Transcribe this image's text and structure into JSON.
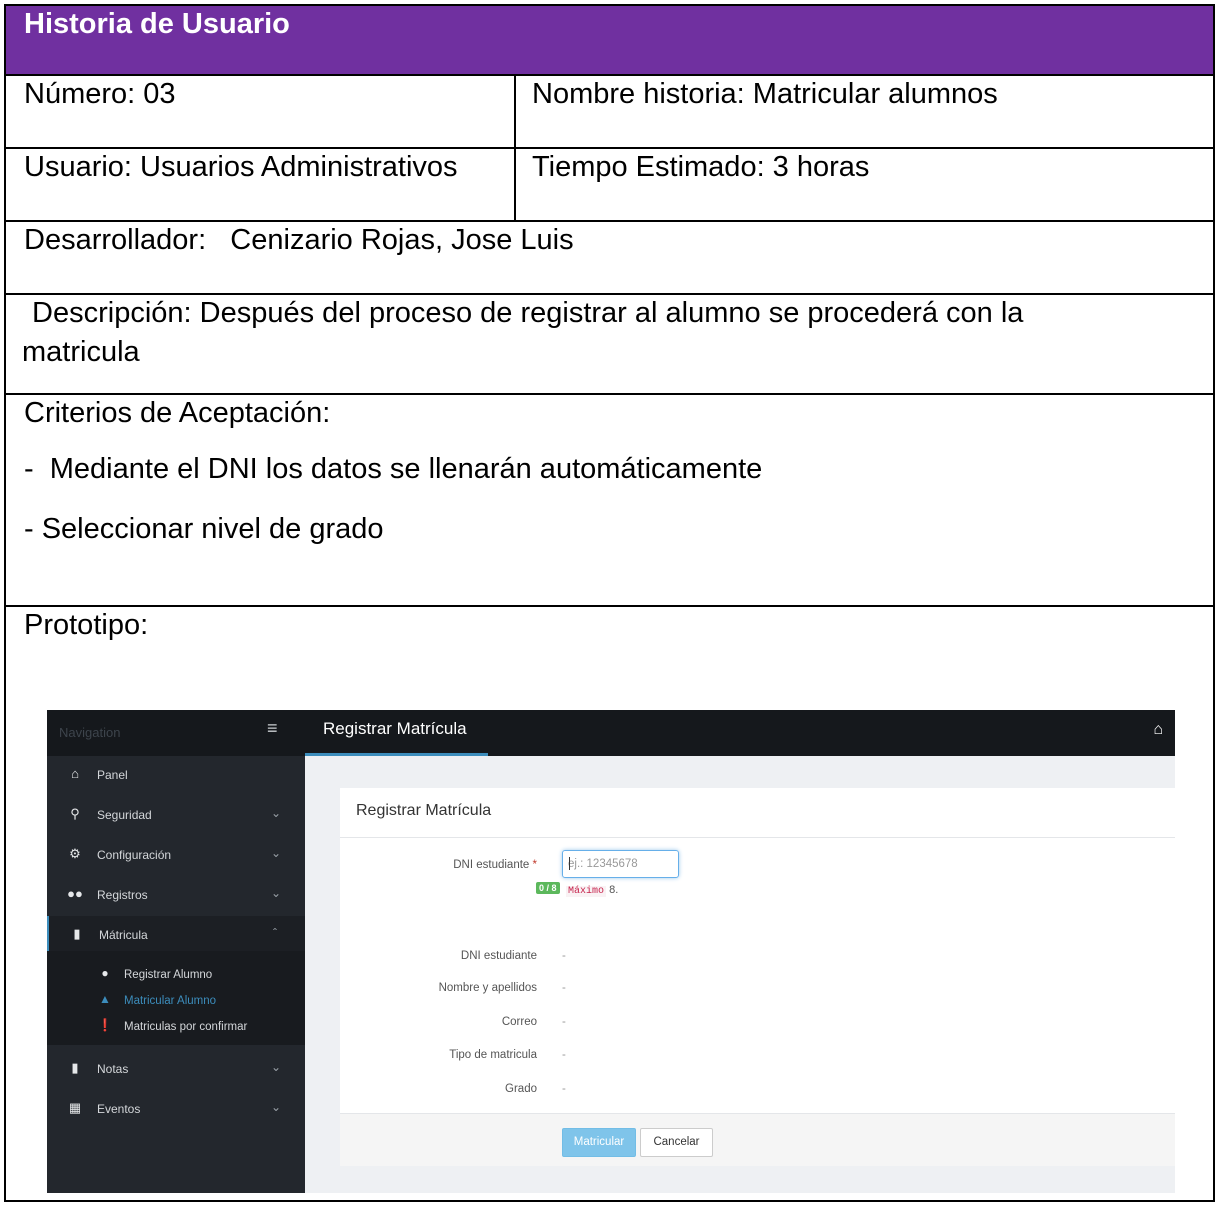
{
  "story": {
    "header": "Historia de Usuario",
    "numero": "Número: 03",
    "nombre_historia": "Nombre historia: Matricular alumnos",
    "usuario": "Usuario: Usuarios Administrativos",
    "tiempo": "Tiempo Estimado: 3 horas",
    "desarrollador": "Desarrollador:   Cenizario Rojas, Jose Luis",
    "descripcion_1": " Descripción: Después del proceso de registrar al alumno se procederá con la",
    "descripcion_2": "matricula",
    "criterios_title": "Criterios de Aceptación:",
    "criterios": [
      "-  Mediante el DNI los datos se llenarán automáticamente",
      "- Seleccionar nivel de grado"
    ],
    "prototipo_label": "Prototipo:",
    "header_color": "#7030a0"
  },
  "prototype": {
    "nav_title": "Navigation",
    "menu_icon": "hamburger-icon",
    "page_title": "Registrar Matrícula",
    "home_icon": "home-icon",
    "sidebar": {
      "items": [
        {
          "label": "Panel",
          "icon": "home-icon"
        },
        {
          "label": "Seguridad",
          "icon": "key-icon"
        },
        {
          "label": "Configuración",
          "icon": "gears-icon"
        },
        {
          "label": "Registros",
          "icon": "users-icon"
        },
        {
          "label": "Mátricula",
          "icon": "book-icon"
        },
        {
          "label": "Notas",
          "icon": "book-icon"
        },
        {
          "label": "Eventos",
          "icon": "calendar-icon"
        }
      ],
      "sub_items": [
        {
          "label": "Registrar Alumno",
          "icon": "user-icon"
        },
        {
          "label": "Matricular Alumno",
          "icon": "graduation-cap-icon"
        },
        {
          "label": "Matriculas por confirmar",
          "icon": "exclamation-circle-icon"
        }
      ]
    },
    "form": {
      "title": "Registrar Matrícula",
      "dni_label": "DNI estudiante",
      "required_mark": "*",
      "dni_placeholder": "ej.: 12345678",
      "counter": "0 / 8",
      "max_code": "Máximo",
      "max_rest": " 8.",
      "fields": [
        {
          "label": "DNI estudiante",
          "value": "-"
        },
        {
          "label": "Nombre y apellidos",
          "value": "-"
        },
        {
          "label": "Correo",
          "value": "-"
        },
        {
          "label": "Tipo de matricula",
          "value": "-"
        },
        {
          "label": "Grado",
          "value": "-"
        }
      ],
      "submit": "Matricular",
      "cancel": "Cancelar"
    },
    "accent_color": "#3c8dbc"
  }
}
